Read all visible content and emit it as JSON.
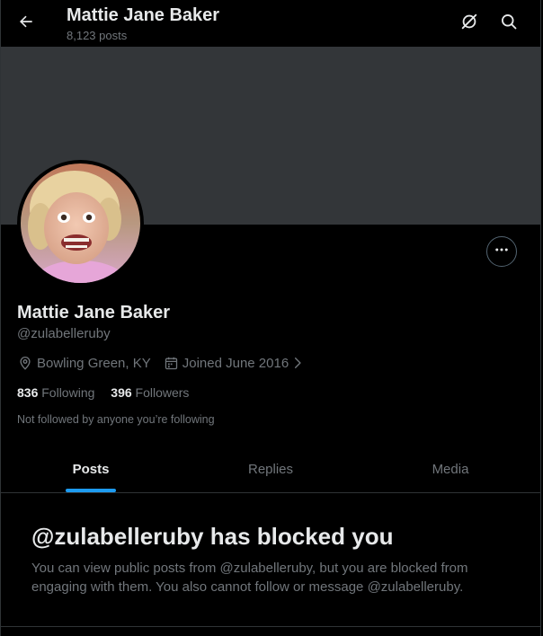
{
  "header": {
    "title": "Mattie Jane Baker",
    "post_count": "8,123 posts"
  },
  "icons": {
    "back": "arrow-left-icon",
    "grok": "grok-icon",
    "search": "search-icon",
    "more": "more-horizontal-icon",
    "location": "location-pin-icon",
    "calendar": "calendar-icon",
    "chevron": "chevron-right-icon"
  },
  "profile": {
    "display_name": "Mattie Jane Baker",
    "handle": "@zulabelleruby",
    "location": "Bowling Green, KY",
    "joined": "Joined June 2016",
    "following_count": "836",
    "following_label": "Following",
    "followers_count": "396",
    "followers_label": "Followers",
    "not_followed_text": "Not followed by anyone you’re following"
  },
  "tabs": [
    {
      "label": "Posts",
      "active": true
    },
    {
      "label": "Replies",
      "active": false
    },
    {
      "label": "Media",
      "active": false
    }
  ],
  "blocked": {
    "title": "@zulabelleruby has blocked you",
    "description": "You can view public posts from @zulabelleruby, but you are blocked from engaging with them. You also cannot follow or message @zulabelleruby."
  },
  "colors": {
    "background": "#000000",
    "banner": "#333639",
    "accent": "#1d9bf0",
    "primary_text": "#e7e9ea",
    "secondary_text": "#71767b",
    "border": "#2f3336"
  }
}
